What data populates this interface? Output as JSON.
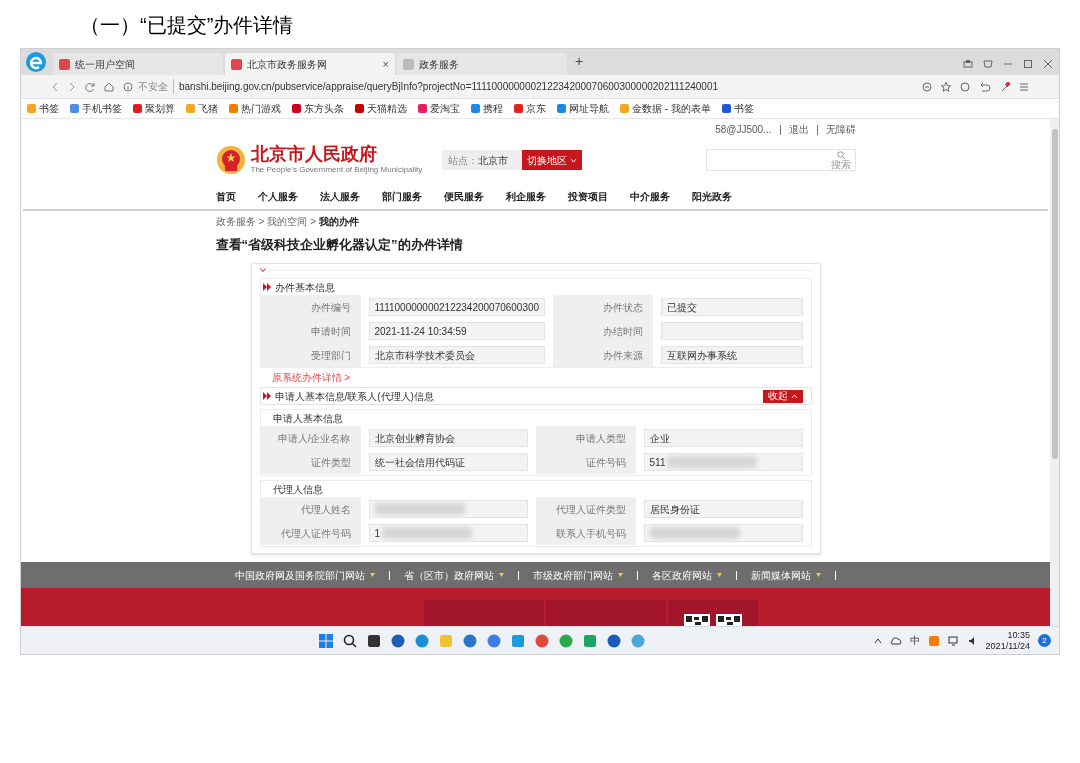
{
  "heading": "（一）“已提交”办件详情",
  "browser": {
    "tabs": [
      {
        "label": "统一用户空间",
        "selected": false
      },
      {
        "label": "北京市政务服务网",
        "selected": true,
        "close": "×"
      },
      {
        "label": "政务服务",
        "selected": false
      }
    ],
    "new_tab": "+",
    "address": {
      "security": "不安全",
      "url": "banshi.beijing.gov.cn/pubservice/appraise/queryBjInfo?projectNo=111100000000212234200070600300000202111240001"
    },
    "bookmarks": [
      {
        "label": "书签",
        "color": "#f5a623"
      },
      {
        "label": "手机书签",
        "color": "#4a90e2"
      },
      {
        "label": "聚划算",
        "color": "#e02020"
      },
      {
        "label": "飞猪",
        "color": "#f5a623"
      },
      {
        "label": "热门游戏",
        "color": "#f57c00"
      },
      {
        "label": "东方头条",
        "color": "#d0021b"
      },
      {
        "label": "天猫精选",
        "color": "#c40000"
      },
      {
        "label": "爱淘宝",
        "color": "#e91e63"
      },
      {
        "label": "携程",
        "color": "#1e88e5"
      },
      {
        "label": "京东",
        "color": "#e1251b"
      },
      {
        "label": "网址导航",
        "color": "#1e88e5"
      },
      {
        "label": "金数据 - 我的表单",
        "color": "#f5a623"
      }
    ],
    "bookmarks_right": {
      "label": "书签",
      "color": "#1e5bd8"
    }
  },
  "user_bar": {
    "account": "58@JJ500...",
    "logout": "退出",
    "accessibility": "无障碍"
  },
  "site": {
    "logo_title": "北京市人民政府",
    "logo_subtitle": "The People's Government of Beijing Municipality",
    "station_label": "站点：",
    "station": "北京市",
    "switch": "切换地区",
    "search_button": "搜索"
  },
  "nav": [
    "首页",
    "个人服务",
    "法人服务",
    "部门服务",
    "便民服务",
    "利企服务",
    "投资项目",
    "中介服务",
    "阳光政务"
  ],
  "breadcrumb": [
    {
      "kind": "link",
      "label": "政务服务"
    },
    {
      "kind": "sep",
      "label": ">"
    },
    {
      "kind": "link",
      "label": "我的空间"
    },
    {
      "kind": "sep",
      "label": ">"
    },
    {
      "kind": "current",
      "label": "我的办件"
    }
  ],
  "page_title": "查看“省级科技企业孵化器认定”的办件详情",
  "basic": {
    "title": "办件基本信息",
    "fields": [
      {
        "label": "办件编号",
        "value": "111100000000212234200070600300"
      },
      {
        "label": "办件状态",
        "value": "已提交"
      },
      {
        "label": "申请时间",
        "value": "2021-11-24 10:34:59"
      },
      {
        "label": "办结时间"
      },
      {
        "label": "受理部门",
        "value": "北京市科学技术委员会"
      },
      {
        "label": "办件来源",
        "value": "互联网办事系统"
      }
    ],
    "link": "原系统办件详情 >"
  },
  "applicant": {
    "title": "申请人基本信息/联系人(代理人)信息",
    "toggle": "收起",
    "expanded": true,
    "groups": [
      {
        "title": "申请人基本信息",
        "fields": [
          {
            "label": "申请人/企业名称",
            "value": "北京创业孵育协会"
          },
          {
            "label": "申请人类型",
            "value": "企业"
          },
          {
            "label": "证件类型",
            "value": "统一社会信用代码证"
          },
          {
            "label": "证件号码",
            "value": "511",
            "redacted": true
          }
        ]
      },
      {
        "title": "代理人信息",
        "fields": [
          {
            "label": "代理人姓名",
            "redacted": true
          },
          {
            "label": "代理人证件类型",
            "value": "居民身份证"
          },
          {
            "label": "代理人证件号码",
            "value": "1",
            "redacted": true
          },
          {
            "label": "联系人手机号码",
            "redacted": true
          }
        ]
      }
    ]
  },
  "footer_links": [
    "中国政府网及国务院部门网站",
    "省（区市）政府网站",
    "市级政府部门网站",
    "各区政府网站",
    "新闻媒体网站"
  ],
  "tray": {
    "ime": "中",
    "time": "10:35",
    "date": "2021/11/24",
    "notifications": "2"
  }
}
